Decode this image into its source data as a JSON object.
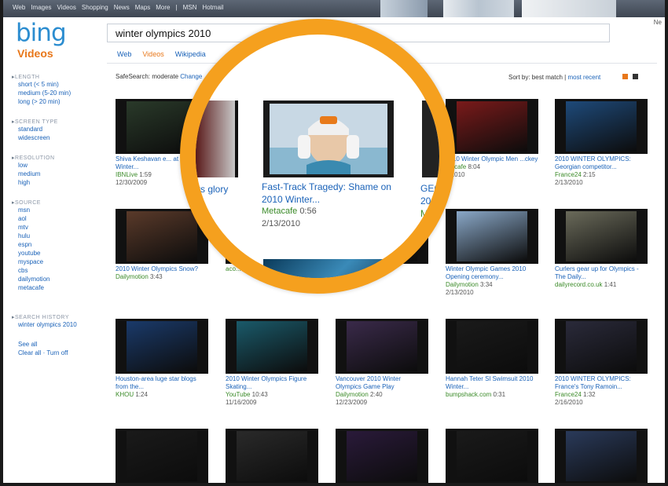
{
  "topbar": {
    "links": [
      "Web",
      "Images",
      "Videos",
      "Shopping",
      "News",
      "Maps",
      "More",
      "|",
      "MSN",
      "Hotmail"
    ],
    "right_text": "Ne"
  },
  "logo": {
    "text": "bing",
    "section": "Videos"
  },
  "search": {
    "value": "winter olympics 2010"
  },
  "tabs": [
    {
      "label": "Web",
      "active": false
    },
    {
      "label": "Videos",
      "active": true
    },
    {
      "label": "Wikipedia",
      "active": false
    }
  ],
  "safesearch": {
    "label": "SafeSearch: moderate",
    "change": "Change"
  },
  "sort": {
    "label": "Sort by: best match",
    "sep": "|",
    "recent": "most recent"
  },
  "sidebar": {
    "sections": [
      {
        "heading": "LENGTH",
        "items": [
          "short (< 5 min)",
          "medium (5-20 min)",
          "long (> 20 min)"
        ]
      },
      {
        "heading": "SCREEN TYPE",
        "items": [
          "standard",
          "widescreen"
        ]
      },
      {
        "heading": "RESOLUTION",
        "items": [
          "low",
          "medium",
          "high"
        ]
      },
      {
        "heading": "SOURCE",
        "items": [
          "msn",
          "aol",
          "mtv",
          "hulu",
          "espn",
          "youtube",
          "myspace",
          "cbs",
          "dailymotion",
          "metacafe"
        ]
      }
    ],
    "history_heading": "SEARCH HISTORY",
    "history_item": "winter olympics 2010",
    "see_all": "See all",
    "clear_all": "Clear all",
    "turn_off": "Turn off"
  },
  "cards": [
    {
      "title": "Shiva Keshavan e... at 2010 Winter...",
      "source": "IBNLive",
      "duration": "1:59",
      "date": "12/30/2009",
      "color": "#2a3a2a"
    },
    {
      "title": "",
      "source": "",
      "duration": "",
      "date": "",
      "color": "#333"
    },
    {
      "title": "",
      "source": "",
      "duration": "",
      "date": "",
      "color": "#333"
    },
    {
      "title": "2010 Winter Olympic Men ...ckey",
      "source": "...acafe",
      "duration": "8:04",
      "date": "...2010",
      "color": "#7a1a1a"
    },
    {
      "title": "2010 WINTER OLYMPICS: Georgian competitor...",
      "source": "France24",
      "duration": "2:15",
      "date": "2/13/2010",
      "color": "#1e4a7a"
    },
    {
      "title": "2010 Winter Olympics Snow?",
      "source": "Dailymotion",
      "duration": "3:43",
      "date": "",
      "color": "#5a3a2a"
    },
    {
      "title": "",
      "source": "aco...",
      "duration": "3:45",
      "date": "",
      "color": "#333"
    },
    {
      "title": "",
      "source": "",
      "duration": "",
      "date": "",
      "color": "#333"
    },
    {
      "title": "Winter Olympic Games 2010 Opening ceremony...",
      "source": "Dailymotion",
      "duration": "3:34",
      "date": "2/13/2010",
      "color": "#8aa8c8"
    },
    {
      "title": "Curlers gear up for Olympics - The Daily...",
      "source": "dailyrecord.co.uk",
      "duration": "1:41",
      "date": "",
      "color": "#6a6a5a"
    },
    {
      "title": "Houston-area luge star blogs from the...",
      "source": "KHOU",
      "duration": "1:24",
      "date": "",
      "color": "#1a3a6a"
    },
    {
      "title": "2010 Winter Olympics Figure Skating...",
      "source": "YouTube",
      "duration": "10:43",
      "date": "11/16/2009",
      "color": "#1a5a6a"
    },
    {
      "title": "Vancouver 2010 Winter Olympics Game Play",
      "source": "Dailymotion",
      "duration": "2:40",
      "date": "12/23/2009",
      "color": "#3a2a4a"
    },
    {
      "title": "Hannah Teter Sl Swimsuit 2010 Winter...",
      "source": "bumpshack.com",
      "duration": "0:31",
      "date": "",
      "color": "#1a1a1a"
    },
    {
      "title": "2010 WINTER OLYMPICS: France's Tony Ramoin...",
      "source": "France24",
      "duration": "1:32",
      "date": "2/16/2010",
      "color": "#2a2a3a"
    },
    {
      "title": "",
      "source": "",
      "duration": "",
      "date": "",
      "color": "#1a1a1a"
    },
    {
      "title": "",
      "source": "",
      "duration": "",
      "date": "",
      "color": "#2a2a2a"
    },
    {
      "title": "",
      "source": "",
      "duration": "",
      "date": "",
      "color": "#2a1a3a"
    },
    {
      "title": "",
      "source": "",
      "duration": "",
      "date": "",
      "color": "#1a1a1a"
    },
    {
      "title": "",
      "source": "",
      "duration": "",
      "date": "",
      "color": "#2a3a5a"
    }
  ],
  "magnified": {
    "title": "Fast-Track Tragedy: Shame on 2010 Winter...",
    "source": "Metacafe",
    "duration": "0:56",
    "date": "2/13/2010",
    "left_text": "rs glory",
    "right_title": "GEO 201",
    "right_src": "M",
    "top_text": "ge",
    "bottom_left": "acco"
  },
  "colors": {
    "accent": "#f5a01e",
    "link": "#1a62b8",
    "source_green": "#3a8a28",
    "brand_orange": "#e8771a"
  }
}
